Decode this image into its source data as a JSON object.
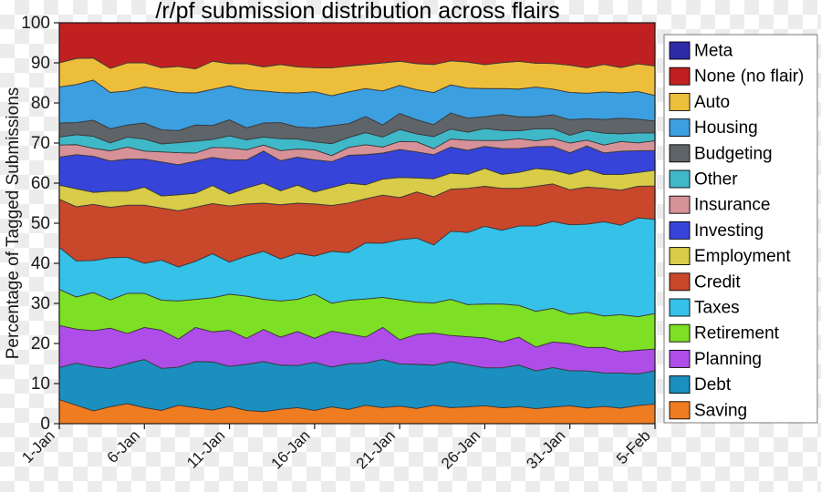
{
  "figure": {
    "title": "/r/pf submission distribution across flairs",
    "background": "#ffffff"
  },
  "chart_data": {
    "type": "area",
    "stacked": true,
    "normalized_percent": true,
    "title": "/r/pf submission distribution across flairs",
    "xlabel": "",
    "ylabel": "Percentage of Tagged Submissions",
    "ylim": [
      0,
      100
    ],
    "ytick_labels": [
      "0",
      "10",
      "20",
      "30",
      "40",
      "50",
      "60",
      "70",
      "80",
      "90",
      "100"
    ],
    "ytick_values": [
      0,
      10,
      20,
      30,
      40,
      50,
      60,
      70,
      80,
      90,
      100
    ],
    "xtick_labels": [
      "1-Jan",
      "6-Jan",
      "11-Jan",
      "16-Jan",
      "21-Jan",
      "26-Jan",
      "31-Jan",
      "5-Feb"
    ],
    "xtick_indices": [
      0,
      5,
      10,
      15,
      20,
      25,
      30,
      35
    ],
    "xtick_rotation_deg": 45,
    "grid": false,
    "legend_position": "right-outside",
    "x": [
      "1-Jan",
      "2-Jan",
      "3-Jan",
      "4-Jan",
      "5-Jan",
      "6-Jan",
      "7-Jan",
      "8-Jan",
      "9-Jan",
      "10-Jan",
      "11-Jan",
      "12-Jan",
      "13-Jan",
      "14-Jan",
      "15-Jan",
      "16-Jan",
      "17-Jan",
      "18-Jan",
      "19-Jan",
      "20-Jan",
      "21-Jan",
      "22-Jan",
      "23-Jan",
      "24-Jan",
      "25-Jan",
      "26-Jan",
      "27-Jan",
      "28-Jan",
      "29-Jan",
      "30-Jan",
      "31-Jan",
      "1-Feb",
      "2-Feb",
      "3-Feb",
      "4-Feb",
      "5-Feb"
    ],
    "series_stack_order_bottom_to_top": [
      "Saving",
      "Debt",
      "Planning",
      "Retirement",
      "Taxes",
      "Credit",
      "Employment",
      "Investing",
      "Insurance",
      "Other",
      "Budgeting",
      "Housing",
      "Auto",
      "None (no flair)",
      "Meta"
    ],
    "series": [
      {
        "name": "Saving",
        "color": "#F07C21",
        "values": [
          6.0,
          4.6,
          3.2,
          4.2,
          5.0,
          4.0,
          3.3,
          4.6,
          4.0,
          3.4,
          4.3,
          3.3,
          3.0,
          3.6,
          4.0,
          3.3,
          4.2,
          3.6,
          4.6,
          4.0,
          4.4,
          3.8,
          4.6,
          4.0,
          4.2,
          4.5,
          4.0,
          4.3,
          3.8,
          4.2,
          4.6,
          4.0,
          4.4,
          4.0,
          4.6,
          5.0
        ]
      },
      {
        "name": "Debt",
        "color": "#1B8FC0",
        "values": [
          8.0,
          10.5,
          11.0,
          9.5,
          10.0,
          12.0,
          10.5,
          9.5,
          11.5,
          12.0,
          10.0,
          11.5,
          12.5,
          11.0,
          10.5,
          12.0,
          10.0,
          11.5,
          10.5,
          12.0,
          10.5,
          11.0,
          10.0,
          11.5,
          10.5,
          9.5,
          10.0,
          10.5,
          9.5,
          10.0,
          9.0,
          9.5,
          8.5,
          9.0,
          8.0,
          8.5
        ]
      },
      {
        "name": "Planning",
        "color": "#AF4DE8",
        "values": [
          10.5,
          8.5,
          9.0,
          10.0,
          7.5,
          8.0,
          9.5,
          7.0,
          8.5,
          7.5,
          9.0,
          6.5,
          8.0,
          7.0,
          8.5,
          6.0,
          9.0,
          7.5,
          6.5,
          8.0,
          6.0,
          7.5,
          8.0,
          6.5,
          7.0,
          7.5,
          6.5,
          7.0,
          6.0,
          6.5,
          7.0,
          6.0,
          6.5,
          5.5,
          6.0,
          5.5
        ]
      },
      {
        "name": "Retirement",
        "color": "#7DE024",
        "values": [
          9.0,
          8.0,
          9.5,
          7.0,
          10.0,
          8.5,
          7.5,
          9.5,
          7.0,
          8.5,
          9.0,
          10.5,
          7.5,
          9.0,
          8.0,
          11.0,
          7.0,
          8.5,
          9.5,
          7.5,
          10.0,
          8.0,
          7.5,
          9.0,
          8.0,
          8.5,
          9.5,
          8.0,
          9.0,
          8.5,
          7.5,
          9.0,
          8.0,
          9.5,
          8.5,
          9.0
        ]
      },
      {
        "name": "Taxes",
        "color": "#35C1E8",
        "values": [
          10.5,
          9.0,
          8.0,
          10.5,
          9.0,
          7.5,
          10.0,
          8.5,
          9.5,
          11.0,
          8.0,
          10.0,
          12.0,
          10.5,
          11.5,
          9.5,
          13.0,
          12.0,
          14.0,
          13.5,
          15.0,
          16.0,
          14.5,
          17.0,
          18.0,
          19.5,
          18.5,
          20.0,
          21.5,
          22.0,
          23.0,
          22.5,
          24.0,
          23.0,
          25.0,
          24.0
        ]
      },
      {
        "name": "Credit",
        "color": "#C9472B",
        "values": [
          12.0,
          13.5,
          14.0,
          12.5,
          13.0,
          14.5,
          13.0,
          14.0,
          13.5,
          12.5,
          14.0,
          13.0,
          12.0,
          13.5,
          12.5,
          13.0,
          11.5,
          12.5,
          11.0,
          12.0,
          10.5,
          11.5,
          12.0,
          10.5,
          11.0,
          10.0,
          10.5,
          9.5,
          10.0,
          9.5,
          9.0,
          9.5,
          8.5,
          9.0,
          8.0,
          8.5
        ]
      },
      {
        "name": "Employment",
        "color": "#D8CC48",
        "values": [
          3.5,
          4.5,
          3.0,
          4.0,
          3.5,
          4.5,
          3.0,
          4.0,
          3.5,
          4.5,
          3.0,
          4.0,
          5.0,
          3.5,
          4.5,
          3.0,
          4.5,
          5.0,
          3.5,
          4.0,
          5.0,
          3.5,
          4.5,
          4.0,
          3.5,
          4.5,
          3.5,
          4.0,
          4.5,
          3.5,
          4.0,
          4.5,
          3.5,
          4.0,
          3.5,
          4.0
        ]
      },
      {
        "name": "Investing",
        "color": "#3644D9",
        "values": [
          7.0,
          8.5,
          9.0,
          7.5,
          8.0,
          7.0,
          8.5,
          7.5,
          8.0,
          7.0,
          8.5,
          7.0,
          8.0,
          7.5,
          7.0,
          8.0,
          6.5,
          7.0,
          7.5,
          6.5,
          7.0,
          6.5,
          6.0,
          6.5,
          6.0,
          5.5,
          6.5,
          6.0,
          5.5,
          6.0,
          5.5,
          6.0,
          5.5,
          6.0,
          5.5,
          5.0
        ]
      },
      {
        "name": "Insurance",
        "color": "#D69298",
        "values": [
          3.0,
          2.5,
          2.0,
          2.5,
          3.0,
          2.0,
          2.5,
          3.0,
          2.0,
          2.5,
          3.0,
          2.5,
          1.5,
          2.5,
          2.0,
          2.5,
          1.5,
          2.0,
          2.5,
          1.5,
          2.0,
          2.5,
          1.5,
          2.0,
          2.5,
          1.5,
          2.0,
          2.5,
          1.5,
          2.0,
          2.5,
          1.5,
          2.0,
          2.5,
          2.0,
          2.5
        ]
      },
      {
        "name": "Other",
        "color": "#3FB8C8",
        "values": [
          2.0,
          2.5,
          3.0,
          2.0,
          2.5,
          3.0,
          2.0,
          2.5,
          3.0,
          2.0,
          3.0,
          2.5,
          2.0,
          3.0,
          2.5,
          2.0,
          3.0,
          2.5,
          3.0,
          2.5,
          3.0,
          2.0,
          3.0,
          2.5,
          2.0,
          3.0,
          2.5,
          2.0,
          3.0,
          2.5,
          2.0,
          2.5,
          3.0,
          2.0,
          2.5,
          2.0
        ]
      },
      {
        "name": "Budgeting",
        "color": "#5F6468",
        "values": [
          3.5,
          3.0,
          4.0,
          3.5,
          3.0,
          4.0,
          3.5,
          3.0,
          4.0,
          3.5,
          4.0,
          3.0,
          3.5,
          4.0,
          3.0,
          3.5,
          4.5,
          3.5,
          4.0,
          3.0,
          4.0,
          3.5,
          3.0,
          4.0,
          3.5,
          3.0,
          4.0,
          3.5,
          3.0,
          3.5,
          4.0,
          3.0,
          3.5,
          4.0,
          3.5,
          3.0
        ]
      },
      {
        "name": "Housing",
        "color": "#3C9FE0",
        "values": [
          9.0,
          9.5,
          10.0,
          9.0,
          8.5,
          9.0,
          10.0,
          9.5,
          8.0,
          9.0,
          8.5,
          9.5,
          8.0,
          7.5,
          8.5,
          9.0,
          7.5,
          8.0,
          7.0,
          8.5,
          7.0,
          7.5,
          8.0,
          7.0,
          7.5,
          7.0,
          6.5,
          7.0,
          7.5,
          6.5,
          7.0,
          6.5,
          7.0,
          6.5,
          7.0,
          6.5
        ]
      },
      {
        "name": "Auto",
        "color": "#EDBE3A",
        "values": [
          6.0,
          6.5,
          5.5,
          6.0,
          7.0,
          6.0,
          5.5,
          6.5,
          6.0,
          7.0,
          5.5,
          6.5,
          6.0,
          7.0,
          6.5,
          6.0,
          7.0,
          6.5,
          6.0,
          7.0,
          6.0,
          6.5,
          7.0,
          6.0,
          6.5,
          6.0,
          6.5,
          7.0,
          6.0,
          6.5,
          7.0,
          6.5,
          7.0,
          6.5,
          7.0,
          7.5
        ]
      },
      {
        "name": "None (no flair)",
        "color": "#C0201F",
        "values": [
          10.0,
          8.9,
          8.8,
          11.3,
          10.0,
          10.0,
          11.2,
          10.9,
          11.5,
          9.6,
          10.2,
          10.2,
          11.0,
          10.4,
          11.0,
          11.2,
          11.3,
          10.9,
          10.4,
          10.0,
          9.6,
          10.2,
          10.4,
          9.5,
          9.8,
          10.5,
          10.0,
          9.7,
          10.2,
          10.3,
          10.9,
          11.5,
          10.6,
          11.5,
          10.4,
          11.0
        ]
      },
      {
        "name": "Meta",
        "color": "#2E2AA8",
        "values": [
          0.0,
          0.0,
          0.0,
          0.0,
          0.0,
          0.0,
          0.0,
          0.0,
          0.0,
          0.0,
          0.0,
          0.0,
          0.0,
          0.0,
          0.0,
          0.0,
          0.0,
          0.0,
          0.0,
          0.0,
          0.0,
          0.0,
          0.0,
          0.0,
          0.0,
          0.0,
          0.0,
          0.0,
          0.0,
          0.0,
          0.0,
          0.0,
          0.0,
          0.0,
          0.0,
          0.0
        ]
      }
    ]
  },
  "legend": {
    "items": [
      {
        "label": "Meta",
        "color": "#2E2AA8"
      },
      {
        "label": "None (no flair)",
        "color": "#C0201F"
      },
      {
        "label": "Auto",
        "color": "#EDBE3A"
      },
      {
        "label": "Housing",
        "color": "#3C9FE0"
      },
      {
        "label": "Budgeting",
        "color": "#5F6468"
      },
      {
        "label": "Other",
        "color": "#3FB8C8"
      },
      {
        "label": "Insurance",
        "color": "#D69298"
      },
      {
        "label": "Investing",
        "color": "#3644D9"
      },
      {
        "label": "Employment",
        "color": "#D8CC48"
      },
      {
        "label": "Credit",
        "color": "#C9472B"
      },
      {
        "label": "Taxes",
        "color": "#35C1E8"
      },
      {
        "label": "Retirement",
        "color": "#7DE024"
      },
      {
        "label": "Planning",
        "color": "#AF4DE8"
      },
      {
        "label": "Debt",
        "color": "#1B8FC0"
      },
      {
        "label": "Saving",
        "color": "#F07C21"
      }
    ]
  }
}
